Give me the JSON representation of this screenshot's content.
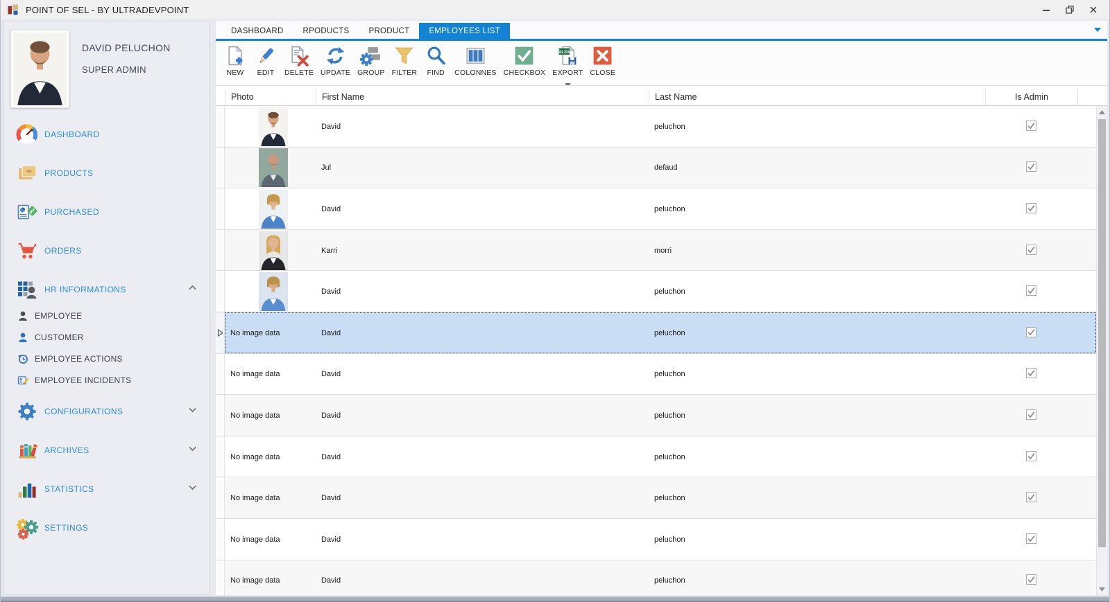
{
  "window": {
    "title": "POINT OF SEL - BY ULTRADEVPOINT",
    "controls": [
      {
        "name": "minimize",
        "glyph": "minus"
      },
      {
        "name": "restore",
        "glyph": "restore"
      },
      {
        "name": "close",
        "glyph": "x"
      }
    ]
  },
  "sidebar": {
    "profile": {
      "name": "DAVID PELUCHON",
      "role": "SUPER ADMIN",
      "photo": "man-beard"
    },
    "items": [
      {
        "id": "dashboard",
        "label": "DASHBOARD",
        "icon": "gauge-icon"
      },
      {
        "id": "products",
        "label": "PRODUCTS",
        "icon": "products-box-icon"
      },
      {
        "id": "purchased",
        "label": "PURCHASED",
        "icon": "purchased-doc-tag-icon"
      },
      {
        "id": "orders",
        "label": "ORDERS",
        "icon": "cart-icon"
      },
      {
        "id": "hr-informations",
        "label": "HR INFORMATIONS",
        "icon": "hr-people-grid-icon",
        "chevron": "up",
        "expanded": true,
        "children": [
          {
            "id": "employee",
            "label": "EMPLOYEE",
            "icon": "person-dark-icon"
          },
          {
            "id": "customer",
            "label": "CUSTOMER",
            "icon": "person-blue-icon"
          },
          {
            "id": "employee-actions",
            "label": "EMPLOYEE ACTIONS",
            "icon": "history-icon"
          },
          {
            "id": "employee-incidents",
            "label": "EMPLOYEE INCIDENTS",
            "icon": "incident-note-icon"
          }
        ]
      },
      {
        "id": "configurations",
        "label": "CONFIGURATIONS",
        "icon": "gear-blue-icon",
        "chevron": "down"
      },
      {
        "id": "archives",
        "label": "ARCHIVES",
        "icon": "books-icon",
        "chevron": "down"
      },
      {
        "id": "statistics",
        "label": "STATISTICS",
        "icon": "bar-chart-icon",
        "chevron": "down"
      },
      {
        "id": "settings",
        "label": "SETTINGS",
        "icon": "gears-multi-icon"
      }
    ]
  },
  "tabs": [
    {
      "label": "DASHBOARD",
      "active": false
    },
    {
      "label": "RPODUCTS",
      "active": false
    },
    {
      "label": "PRODUCT",
      "active": false
    },
    {
      "label": "EMPLOYEES LIST",
      "active": true
    }
  ],
  "toolbar": [
    {
      "label": "NEW",
      "icon": "new-page-icon"
    },
    {
      "label": "EDIT",
      "icon": "edit-pencil-icon"
    },
    {
      "label": "DELETE",
      "icon": "delete-page-icon"
    },
    {
      "label": "UPDATE",
      "icon": "refresh-icon"
    },
    {
      "label": "GROUP",
      "icon": "group-gear-icon"
    },
    {
      "label": "FILTER",
      "icon": "filter-funnel-icon"
    },
    {
      "label": "FIND",
      "icon": "search-icon"
    },
    {
      "label": "COLONNES",
      "icon": "columns-icon"
    },
    {
      "label": "CHECKBOX",
      "icon": "checkbox-icon"
    },
    {
      "label": "EXPORT",
      "icon": "export-xlsx-icon",
      "dropdown": true
    },
    {
      "label": "CLOSE",
      "icon": "close-x-icon"
    }
  ],
  "grid": {
    "columns": [
      "Photo",
      "First Name",
      "Last Name",
      "Is Admin"
    ],
    "no_image_text": "No image data",
    "rows": [
      {
        "photo": "man-beard",
        "first_name": "David",
        "last_name": "peluchon",
        "is_admin": true
      },
      {
        "photo": "man-bald",
        "first_name": "Jul",
        "last_name": "defaud",
        "is_admin": true
      },
      {
        "photo": "woman-blue",
        "first_name": "David",
        "last_name": "peluchon",
        "is_admin": true
      },
      {
        "photo": "woman-black",
        "first_name": "Karri",
        "last_name": "morri",
        "is_admin": true
      },
      {
        "photo": "woman-blue-2",
        "first_name": "David",
        "last_name": "peluchon",
        "is_admin": true
      },
      {
        "photo": null,
        "first_name": "David",
        "last_name": "peluchon",
        "is_admin": true,
        "selected": true
      },
      {
        "photo": null,
        "first_name": "David",
        "last_name": "peluchon",
        "is_admin": true
      },
      {
        "photo": null,
        "first_name": "David",
        "last_name": "peluchon",
        "is_admin": true
      },
      {
        "photo": null,
        "first_name": "David",
        "last_name": "peluchon",
        "is_admin": true
      },
      {
        "photo": null,
        "first_name": "David",
        "last_name": "peluchon",
        "is_admin": true
      },
      {
        "photo": null,
        "first_name": "David",
        "last_name": "peluchon",
        "is_admin": true
      },
      {
        "photo": null,
        "first_name": "David",
        "last_name": "peluchon",
        "is_admin": true
      }
    ]
  },
  "colors": {
    "accent": "#1384d5",
    "selection": "#c9def5",
    "sidebar_link": "#2b8fd8",
    "titlebar_bg": "#f0f0f0"
  }
}
